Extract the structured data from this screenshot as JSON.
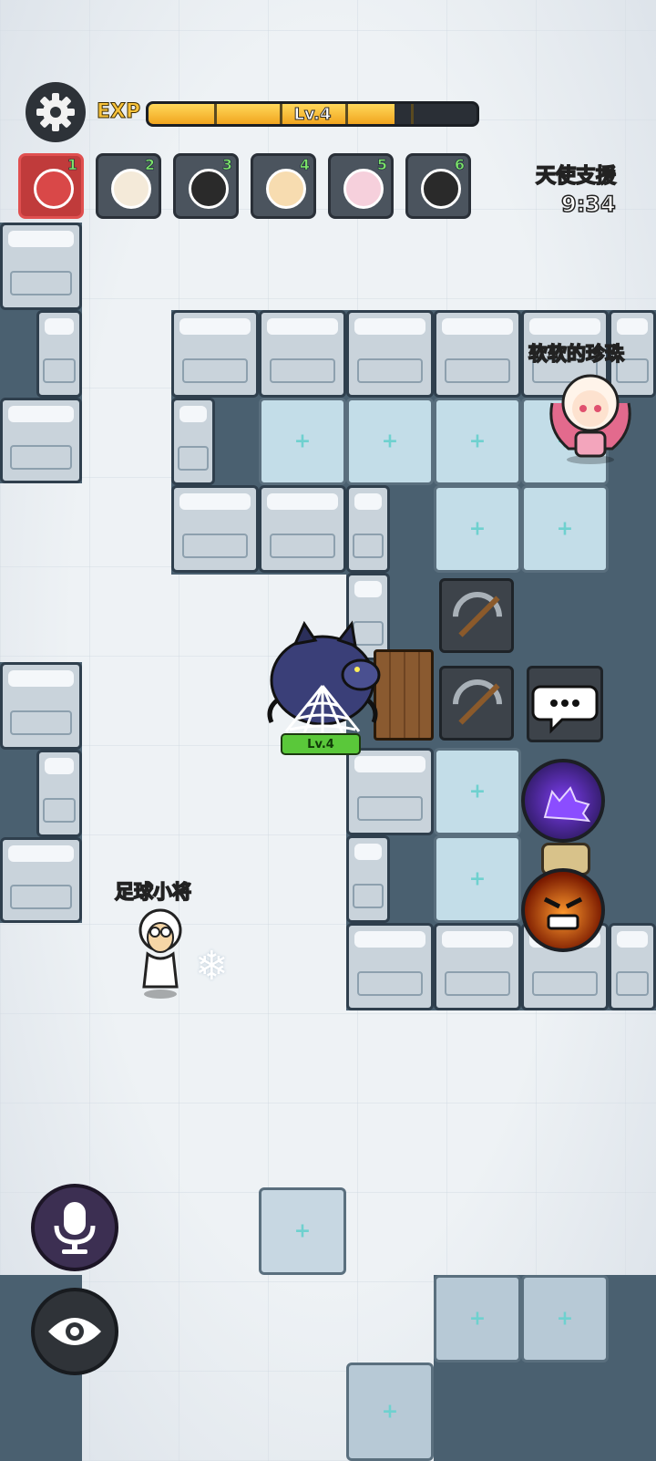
{
  "hud": {
    "exp_label": "EXP",
    "level_text": "Lv.4",
    "exp_progress": 0.75,
    "angel_support_label": "天使支援",
    "angel_support_timer": "9:34"
  },
  "player_slots": [
    {
      "number": "1",
      "character": "claw-avatar",
      "active": true
    },
    {
      "number": "2",
      "character": "sheep-crowned-avatar",
      "active": false
    },
    {
      "number": "3",
      "character": "black-sheep-avatar",
      "active": false
    },
    {
      "number": "4",
      "character": "sheep-avatar",
      "active": false
    },
    {
      "number": "5",
      "character": "pink-sheep-avatar",
      "active": false
    },
    {
      "number": "6",
      "character": "black-sheep-avatar",
      "active": false
    }
  ],
  "players": {
    "top_right_name": "软软的珍珠",
    "left_player_name": "足球小将"
  },
  "monster": {
    "level_text": "Lv.4",
    "type": "werewolf"
  },
  "colors": {
    "exp_fill": "#f1a51f",
    "active_slot": "#c03b3b",
    "level_tag": "#5ac83a",
    "wall_outline": "#2f3f4d"
  }
}
